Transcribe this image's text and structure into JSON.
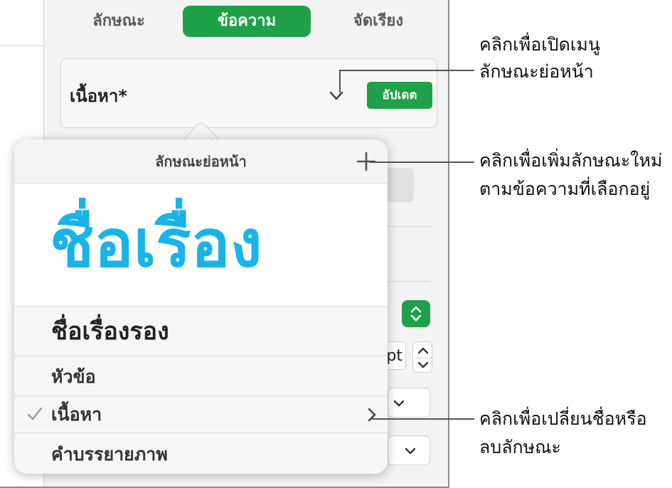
{
  "tabs": [
    "ลักษณะ",
    "ข้อความ",
    "จัดเรียง"
  ],
  "style_box": {
    "name": "เนื้อหา*",
    "update_label": "อัปเดต"
  },
  "popover": {
    "title": "ลักษณะย่อหน้า",
    "styles": {
      "title": "ชื่อเรื่อง",
      "subtitle": "ชื่อเรื่องรอง",
      "heading": "หัวข้อ",
      "body": "เนื้อหา",
      "caption": "คำบรรยายภาพ"
    },
    "selected": "เนื้อหา"
  },
  "inspector_partial": {
    "unit": "pt"
  },
  "callouts": {
    "menu_1": "คลิกเพื่อเปิดเมนู",
    "menu_2": "ลักษณะย่อหน้า",
    "add_1": "คลิกเพื่อเพิ่มลักษณะใหม่",
    "add_2": "ตามข้อความที่เลือกอยู่",
    "rename_1": "คลิกเพื่อเปลี่ยนชื่อหรือ",
    "rename_2": "ลบลักษณะ"
  },
  "colors": {
    "accent_green": "#1fa14a",
    "title_blue": "#1ab3e8"
  }
}
